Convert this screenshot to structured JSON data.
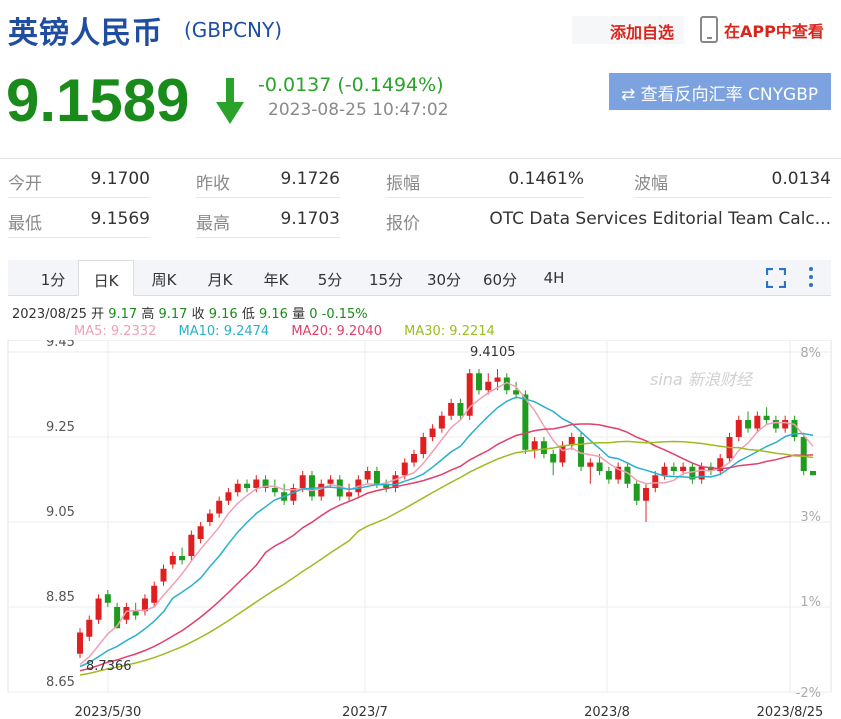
{
  "header": {
    "title": "英镑人民币",
    "code": "(GBPCNY)",
    "add_favorite": "添加自选",
    "view_in_app": "在APP中查看"
  },
  "quote": {
    "price": "9.1589",
    "change": "-0.0137 (-0.1494%)",
    "timestamp": "2023-08-25 10:47:02",
    "reverse_button": "⇄ 查看反向汇率 CNYGBP"
  },
  "stats": {
    "open_label": "今开",
    "open": "9.1700",
    "prev_close_label": "昨收",
    "prev_close": "9.1726",
    "amplitude_label": "振幅",
    "amplitude": "0.1461%",
    "wave_label": "波幅",
    "wave": "0.0134",
    "low_label": "最低",
    "low": "9.1569",
    "high_label": "最高",
    "high": "9.1703",
    "quote_label": "报价",
    "quote_source": "OTC Data Services Editorial Team Calc..."
  },
  "tabs": [
    "1分",
    "日K",
    "周K",
    "月K",
    "年K",
    "5分",
    "15分",
    "30分",
    "60分",
    "4H"
  ],
  "active_tab": "日K",
  "info_line": {
    "date": "2023/08/25",
    "open_label": "开",
    "open": "9.17",
    "high_label": "高",
    "high": "9.17",
    "close_label": "收",
    "close": "9.16",
    "low_label": "低",
    "low": "9.16",
    "volume_label": "量",
    "volume": "0",
    "change_pct": "-0.15%"
  },
  "ma": {
    "ma5": "MA5: 9.2332",
    "ma10": "MA10: 9.2474",
    "ma20": "MA20: 9.2040",
    "ma30": "MA30: 9.2214"
  },
  "colors": {
    "up": "#e02020",
    "down": "#1f9b1f",
    "ma5": "#f0a0b4",
    "ma10": "#2ab0cc",
    "ma20": "#e0406a",
    "ma30": "#9cbc20",
    "brand_blue": "#1f4ea1"
  },
  "watermark": "sina 新浪财经",
  "chart_data": {
    "type": "candlestick",
    "y_ticks": [
      "9.45",
      "9.25",
      "9.05",
      "8.85",
      "8.65"
    ],
    "y_pct_ticks": [
      "8%",
      "3%",
      "1%",
      "-2%"
    ],
    "x_ticks": [
      "2023/5/30",
      "2023/7",
      "2023/8",
      "2023/8/25"
    ],
    "ylim": [
      8.65,
      9.45
    ],
    "max_label": "9.4105",
    "min_label": "8.7366",
    "grid": true,
    "candles": [
      [
        8.74,
        8.79,
        8.73,
        8.8
      ],
      [
        8.78,
        8.82,
        8.77,
        8.83
      ],
      [
        8.82,
        8.87,
        8.81,
        8.88
      ],
      [
        8.88,
        8.86,
        8.85,
        8.89
      ],
      [
        8.85,
        8.8,
        8.8,
        8.86
      ],
      [
        8.82,
        8.85,
        8.81,
        8.86
      ],
      [
        8.84,
        8.83,
        8.82,
        8.86
      ],
      [
        8.84,
        8.87,
        8.83,
        8.88
      ],
      [
        8.86,
        8.9,
        8.85,
        8.91
      ],
      [
        8.91,
        8.94,
        8.9,
        8.95
      ],
      [
        8.95,
        8.97,
        8.94,
        8.98
      ],
      [
        8.97,
        8.96,
        8.95,
        8.99
      ],
      [
        8.97,
        9.02,
        8.96,
        9.03
      ],
      [
        9.01,
        9.04,
        9.0,
        9.05
      ],
      [
        9.05,
        9.07,
        9.04,
        9.08
      ],
      [
        9.07,
        9.1,
        9.06,
        9.11
      ],
      [
        9.1,
        9.12,
        9.09,
        9.13
      ],
      [
        9.12,
        9.14,
        9.11,
        9.15
      ],
      [
        9.14,
        9.13,
        9.12,
        9.15
      ],
      [
        9.13,
        9.15,
        9.12,
        9.16
      ],
      [
        9.15,
        9.13,
        9.12,
        9.16
      ],
      [
        9.13,
        9.12,
        9.11,
        9.15
      ],
      [
        9.12,
        9.1,
        9.09,
        9.14
      ],
      [
        9.1,
        9.13,
        9.09,
        9.14
      ],
      [
        9.13,
        9.16,
        9.12,
        9.17
      ],
      [
        9.16,
        9.11,
        9.1,
        9.17
      ],
      [
        9.11,
        9.14,
        9.1,
        9.15
      ],
      [
        9.14,
        9.15,
        9.13,
        9.16
      ],
      [
        9.15,
        9.11,
        9.1,
        9.16
      ],
      [
        9.11,
        9.12,
        9.1,
        9.14
      ],
      [
        9.12,
        9.15,
        9.11,
        9.16
      ],
      [
        9.15,
        9.17,
        9.14,
        9.18
      ],
      [
        9.17,
        9.14,
        9.13,
        9.18
      ],
      [
        9.14,
        9.13,
        9.12,
        9.15
      ],
      [
        9.13,
        9.16,
        9.12,
        9.17
      ],
      [
        9.16,
        9.19,
        9.15,
        9.2
      ],
      [
        9.19,
        9.21,
        9.18,
        9.22
      ],
      [
        9.21,
        9.25,
        9.2,
        9.26
      ],
      [
        9.25,
        9.27,
        9.24,
        9.28
      ],
      [
        9.27,
        9.3,
        9.26,
        9.31
      ],
      [
        9.3,
        9.33,
        9.29,
        9.34
      ],
      [
        9.33,
        9.3,
        9.29,
        9.34
      ],
      [
        9.3,
        9.4,
        9.29,
        9.41
      ],
      [
        9.4,
        9.36,
        9.35,
        9.41
      ],
      [
        9.36,
        9.38,
        9.35,
        9.4
      ],
      [
        9.38,
        9.39,
        9.36,
        9.41
      ],
      [
        9.39,
        9.36,
        9.35,
        9.4
      ],
      [
        9.36,
        9.35,
        9.34,
        9.38
      ],
      [
        9.35,
        9.22,
        9.21,
        9.36
      ],
      [
        9.22,
        9.24,
        9.2,
        9.25
      ],
      [
        9.24,
        9.21,
        9.2,
        9.25
      ],
      [
        9.21,
        9.19,
        9.16,
        9.22
      ],
      [
        9.19,
        9.23,
        9.18,
        9.24
      ],
      [
        9.23,
        9.25,
        9.22,
        9.26
      ],
      [
        9.25,
        9.18,
        9.17,
        9.26
      ],
      [
        9.18,
        9.19,
        9.14,
        9.2
      ],
      [
        9.19,
        9.17,
        9.16,
        9.21
      ],
      [
        9.17,
        9.15,
        9.14,
        9.18
      ],
      [
        9.15,
        9.18,
        9.14,
        9.19
      ],
      [
        9.18,
        9.14,
        9.13,
        9.19
      ],
      [
        9.14,
        9.1,
        9.09,
        9.15
      ],
      [
        9.1,
        9.13,
        9.05,
        9.14
      ],
      [
        9.13,
        9.16,
        9.12,
        9.17
      ],
      [
        9.16,
        9.18,
        9.15,
        9.19
      ],
      [
        9.18,
        9.17,
        9.16,
        9.19
      ],
      [
        9.17,
        9.18,
        9.16,
        9.19
      ],
      [
        9.18,
        9.15,
        9.14,
        9.19
      ],
      [
        9.15,
        9.18,
        9.14,
        9.19
      ],
      [
        9.18,
        9.17,
        9.16,
        9.19
      ],
      [
        9.17,
        9.2,
        9.16,
        9.21
      ],
      [
        9.2,
        9.25,
        9.19,
        9.26
      ],
      [
        9.25,
        9.29,
        9.24,
        9.3
      ],
      [
        9.29,
        9.27,
        9.26,
        9.31
      ],
      [
        9.27,
        9.3,
        9.26,
        9.31
      ],
      [
        9.3,
        9.29,
        9.28,
        9.32
      ],
      [
        9.29,
        9.27,
        9.26,
        9.3
      ],
      [
        9.27,
        9.29,
        9.26,
        9.3
      ],
      [
        9.29,
        9.25,
        9.24,
        9.3
      ],
      [
        9.25,
        9.17,
        9.16,
        9.26
      ],
      [
        9.17,
        9.16,
        9.16,
        9.17
      ]
    ]
  }
}
